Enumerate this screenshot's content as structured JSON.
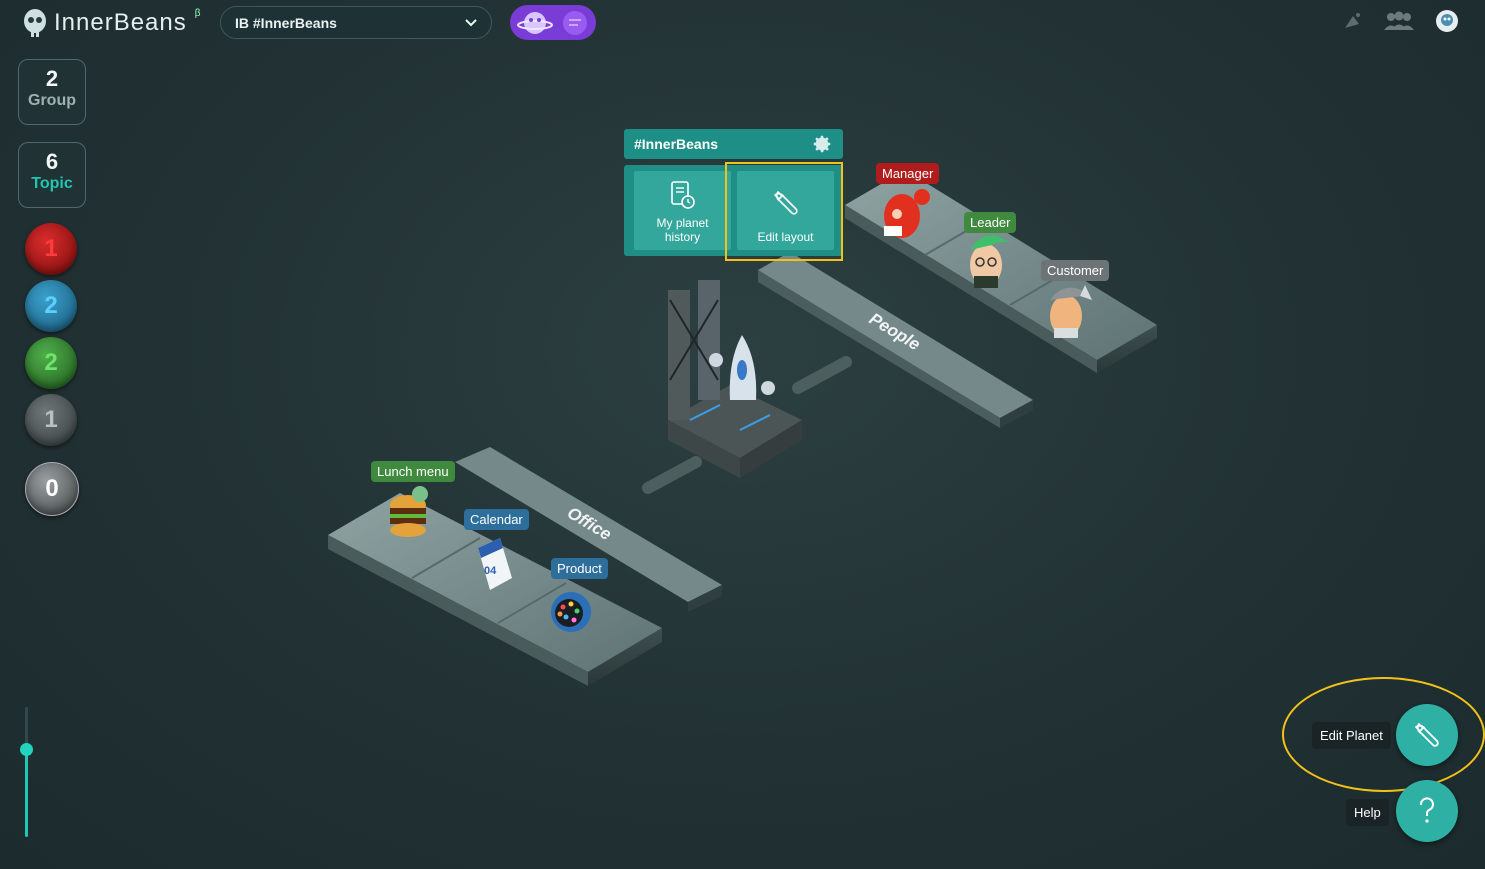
{
  "app": {
    "logo_text": "InnerBeans",
    "beta_mark": "β"
  },
  "workspace": {
    "prefix": "IB",
    "name": "#InnerBeans"
  },
  "counters": {
    "group_count": "2",
    "group_label": "Group",
    "topic_count": "6",
    "topic_label": "Topic"
  },
  "mood_bubbles": [
    {
      "value": "1",
      "color": "#c01717"
    },
    {
      "value": "2",
      "color": "#2a87b4"
    },
    {
      "value": "2",
      "color": "#3f9a3c"
    },
    {
      "value": "1",
      "color": "#5f6668"
    },
    {
      "value": "0",
      "color": "#7a7f80"
    }
  ],
  "zoom_level": 0.72,
  "planet_card": {
    "title": "#InnerBeans",
    "history_label_1": "My planet",
    "history_label_2": "history",
    "edit_layout_label": "Edit layout"
  },
  "islands": {
    "people_label": "People",
    "office_label": "Office"
  },
  "members": {
    "manager": "Manager",
    "leader": "Leader",
    "customer": "Customer"
  },
  "office_items": {
    "lunch": "Lunch menu",
    "calendar": "Calendar",
    "product": "Product",
    "calendar_day": "04"
  },
  "actions": {
    "edit_planet": "Edit Planet",
    "help": "Help"
  },
  "colors": {
    "accent": "#2fb0a4",
    "highlight": "#f3c21a",
    "planet_toggle": "#7a3cd6"
  }
}
